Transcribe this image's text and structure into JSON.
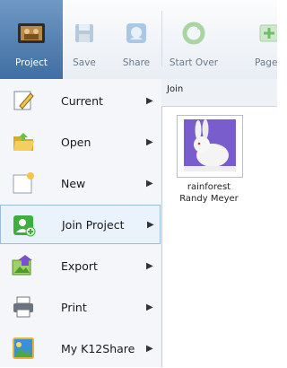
{
  "toolbar": {
    "buttons": [
      {
        "label": "Project",
        "icon": "project-icon",
        "active": true
      },
      {
        "label": "Save",
        "icon": "save-icon"
      },
      {
        "label": "Share",
        "icon": "share-icon"
      },
      {
        "label": "Start Over",
        "icon": "start-over-icon"
      },
      {
        "label": "Page",
        "icon": "add-page-icon"
      }
    ]
  },
  "menu": {
    "items": [
      {
        "label": "Current",
        "icon": "pencil-note-icon",
        "arrow": "▶"
      },
      {
        "label": "Open",
        "icon": "open-folder-icon",
        "arrow": "▶"
      },
      {
        "label": "New",
        "icon": "new-document-icon",
        "arrow": "▶"
      },
      {
        "label": "Join Project",
        "icon": "join-project-icon",
        "arrow": "▶",
        "selected": true
      },
      {
        "label": "Export",
        "icon": "export-icon",
        "arrow": "▶"
      },
      {
        "label": "Print",
        "icon": "printer-icon",
        "arrow": "▶"
      },
      {
        "label": "My K12Share",
        "icon": "k12share-icon",
        "arrow": "▶"
      }
    ]
  },
  "pane": {
    "header": "Join",
    "project": {
      "line1": "rainforest",
      "line2": "Randy Meyer"
    }
  },
  "colors": {
    "accent": "#4f7fb3",
    "selection_border": "#9bbcdc"
  }
}
